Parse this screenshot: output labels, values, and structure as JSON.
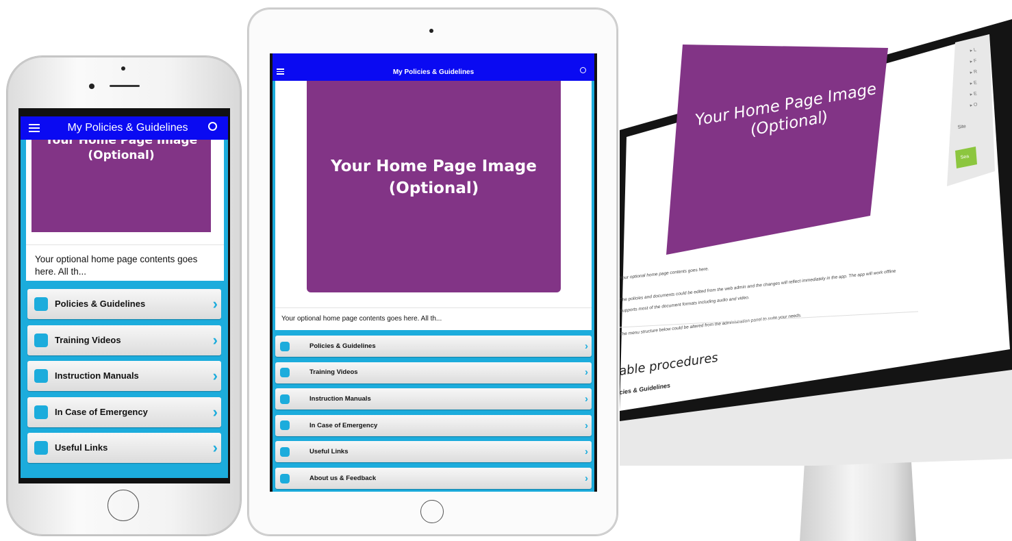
{
  "phone": {
    "app_title": "My Policies & Guidelines",
    "hero_text": "Your Home Page Image\n(Optional)",
    "intro_text": "Your optional home page contents goes here. All th...",
    "menu": [
      {
        "label": "Policies & Guidelines"
      },
      {
        "label": "Training Videos"
      },
      {
        "label": "Instruction Manuals"
      },
      {
        "label": "In Case of Emergency"
      },
      {
        "label": "Useful Links"
      }
    ]
  },
  "tablet": {
    "app_title": "My Policies & Guidelines",
    "hero_text": "Your Home Page Image\n(Optional)",
    "intro_text": "Your optional home page contents goes here. All th...",
    "menu": [
      {
        "label": "Policies & Guidelines"
      },
      {
        "label": "Training Videos"
      },
      {
        "label": "Instruction Manuals"
      },
      {
        "label": "In Case of Emergency"
      },
      {
        "label": "Useful Links"
      },
      {
        "label": "About us & Feedback"
      }
    ]
  },
  "monitor": {
    "hero_text": "Your Home Page Image\n(Optional)",
    "paragraphs": [
      "Your optional home page contents goes here.",
      "The policies and documents could be edited from the web admin and the changes will reflect immediately in the app. The app will work offline",
      "Supports most of the document formats including audio and video.",
      "The menu structure below could be altered from the administration panel to suite your needs."
    ],
    "section_heading": "able procedures",
    "section_item": "cies & Guidelines",
    "sidebar_items": [
      "L",
      "F",
      "R",
      "E",
      "E",
      "O"
    ],
    "sidebar_site_label": "Site",
    "sidebar_button": "Sea"
  },
  "colors": {
    "app_bar": "#0a0af2",
    "accent": "#1cacdc",
    "hero": "#823486",
    "green_button": "#8cc63f"
  },
  "icons": [
    "menu-icon",
    "search-icon",
    "chevron-right-icon",
    "home-button-icon",
    "camera-icon"
  ]
}
